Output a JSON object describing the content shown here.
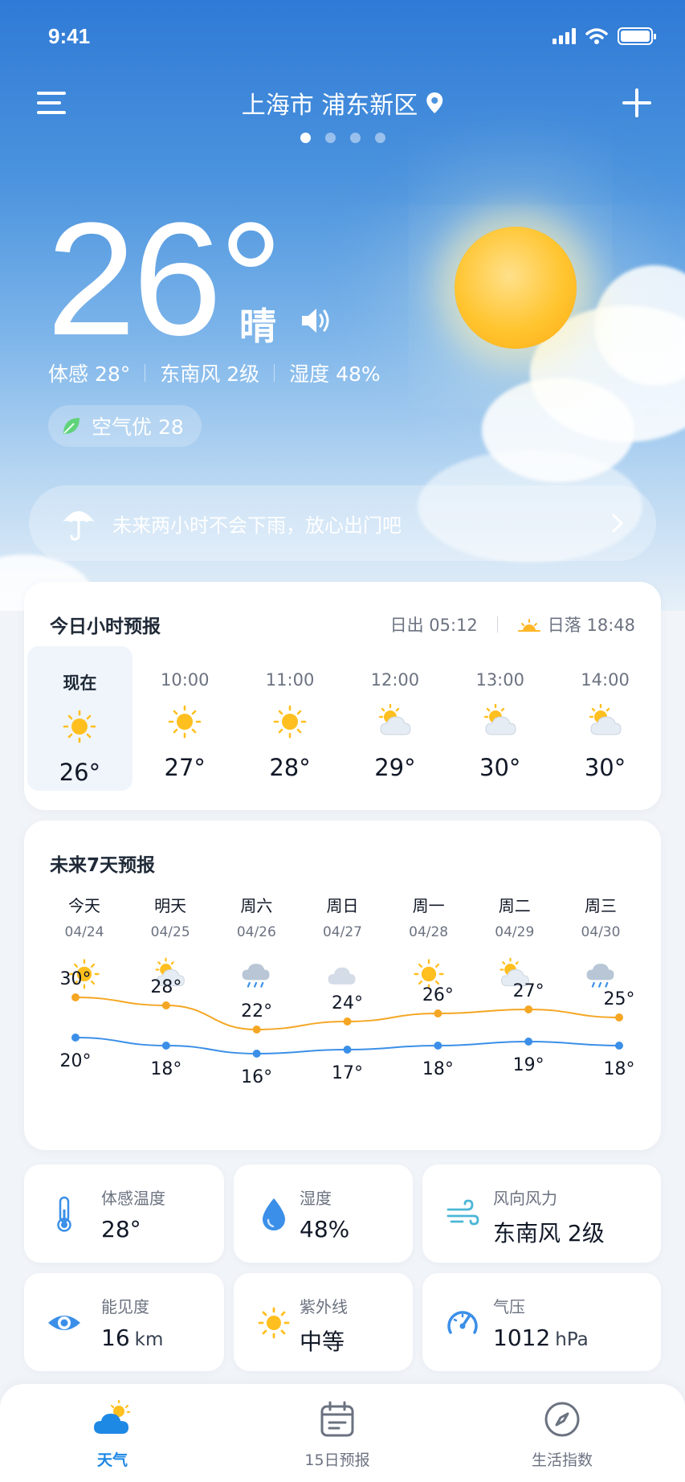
{
  "status": {
    "time": "9:41"
  },
  "header": {
    "location": "上海市 浦东新区"
  },
  "current": {
    "temp": "26°",
    "condition": "晴",
    "feels_like": "体感 28°",
    "wind": "东南风 2级",
    "humidity": "湿度 48%",
    "aqi": "空气优 28",
    "rain_notice": "未来两小时不会下雨，放心出门吧"
  },
  "hourly": {
    "title": "今日小时预报",
    "sunrise": "日出  05:12",
    "sunset": "日落  18:48",
    "items": [
      {
        "label": "现在",
        "temp": "26°",
        "icon": "sun-icon"
      },
      {
        "label": "10:00",
        "temp": "27°",
        "icon": "sun-icon"
      },
      {
        "label": "11:00",
        "temp": "28°",
        "icon": "sun-icon"
      },
      {
        "label": "12:00",
        "temp": "29°",
        "icon": "partly-cloudy-icon"
      },
      {
        "label": "13:00",
        "temp": "30°",
        "icon": "partly-cloudy-icon"
      },
      {
        "label": "14:00",
        "temp": "30°",
        "icon": "partly-cloudy-icon"
      }
    ]
  },
  "weekly": {
    "title": "未来7天预报",
    "days": [
      {
        "name": "今天",
        "date": "04/24",
        "icon": "sun-icon",
        "high": "30°",
        "low": "20°"
      },
      {
        "name": "明天",
        "date": "04/25",
        "icon": "partly-cloudy-icon",
        "high": "28°",
        "low": "18°"
      },
      {
        "name": "周六",
        "date": "04/26",
        "icon": "rain-icon",
        "high": "22°",
        "low": "16°"
      },
      {
        "name": "周日",
        "date": "04/27",
        "icon": "cloud-icon",
        "high": "24°",
        "low": "17°"
      },
      {
        "name": "周一",
        "date": "04/28",
        "icon": "sun-icon",
        "high": "26°",
        "low": "18°"
      },
      {
        "name": "周二",
        "date": "04/29",
        "icon": "partly-cloudy-icon",
        "high": "27°",
        "low": "19°"
      },
      {
        "name": "周三",
        "date": "04/30",
        "icon": "rain-icon",
        "high": "25°",
        "low": "18°"
      }
    ]
  },
  "chart_data": {
    "type": "line",
    "categories": [
      "04/24",
      "04/25",
      "04/26",
      "04/27",
      "04/28",
      "04/29",
      "04/30"
    ],
    "series": [
      {
        "values": [
          30,
          28,
          22,
          24,
          26,
          27,
          25
        ],
        "color": "#f5a623"
      },
      {
        "values": [
          20,
          18,
          16,
          17,
          18,
          19,
          18
        ],
        "color": "#3b8fe8"
      }
    ],
    "grid": false
  },
  "details": {
    "feels": {
      "label": "体感温度",
      "value": "28°"
    },
    "humidity": {
      "label": "湿度",
      "value": "48%"
    },
    "wind": {
      "label": "风向风力",
      "value": "东南风 2级"
    },
    "visibility": {
      "label": "能见度",
      "value": "16",
      "unit": "km"
    },
    "uv": {
      "label": "紫外线",
      "value": "中等"
    },
    "pressure": {
      "label": "气压",
      "value": "1012",
      "unit": "hPa"
    }
  },
  "tabs": [
    {
      "label": "天气",
      "icon": "weather-icon"
    },
    {
      "label": "15日预报",
      "icon": "calendar-icon"
    },
    {
      "label": "生活指数",
      "icon": "compass-icon"
    }
  ],
  "colors": {
    "accent": "#1e88e5",
    "sun": "#ffbf1f",
    "high_line": "#f5a623",
    "low_line": "#3b8fe8"
  }
}
